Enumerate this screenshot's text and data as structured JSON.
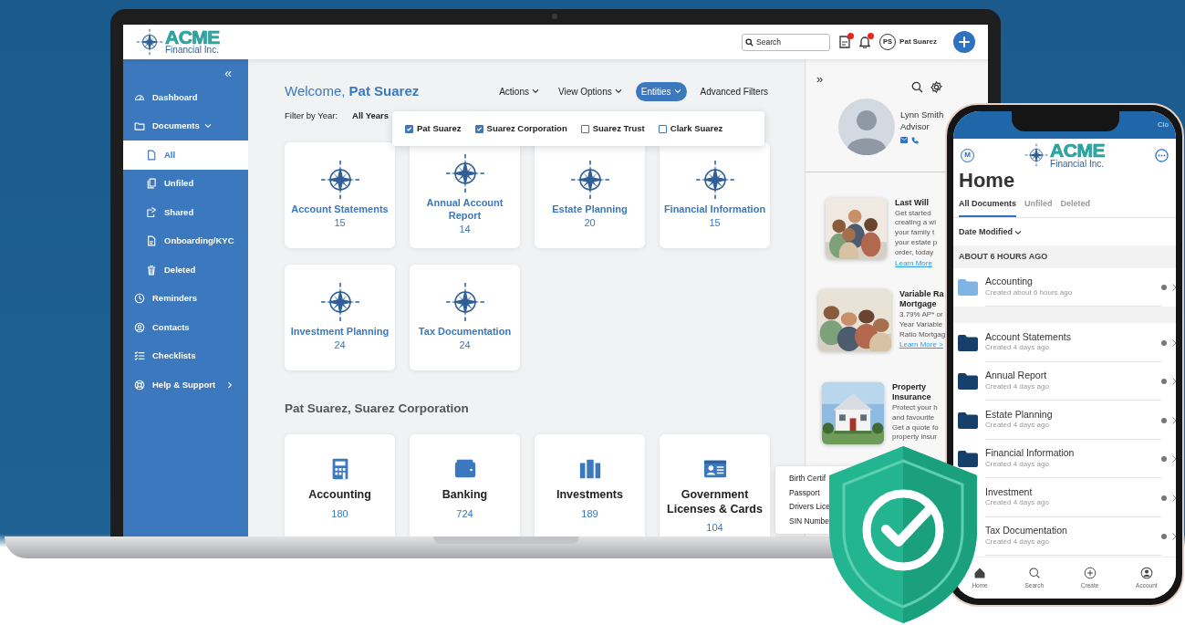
{
  "header": {
    "logo_mark": "ACME",
    "logo_sub": "Financial Inc.",
    "search": {
      "placeholder": "Search"
    },
    "user": {
      "initials": "PS",
      "name": "Pat Suarez"
    }
  },
  "sidebar": {
    "collapse": "«",
    "items": [
      {
        "label": "Dashboard",
        "selected": false
      },
      {
        "label": "Documents",
        "selected": false,
        "expanded": true,
        "children": [
          {
            "label": "All",
            "selected": true
          },
          {
            "label": "Unfiled",
            "selected": false
          },
          {
            "label": "Shared",
            "selected": false
          },
          {
            "label": "Onboarding/KYC",
            "selected": false
          },
          {
            "label": "Deleted",
            "selected": false
          }
        ]
      },
      {
        "label": "Reminders",
        "selected": false
      },
      {
        "label": "Contacts",
        "selected": false
      },
      {
        "label": "Checklists",
        "selected": false
      },
      {
        "label": "Help & Support",
        "selected": false,
        "expanded": false
      }
    ]
  },
  "main": {
    "greeting": "Welcome,",
    "user": "Pat Suarez",
    "menus": [
      {
        "label": "Actions",
        "kind": "dropdown",
        "selected": false
      },
      {
        "label": "View Options",
        "kind": "dropdown",
        "selected": false
      },
      {
        "label": "Entities",
        "kind": "dropdown",
        "selected": true
      },
      {
        "label": "Advanced Filters",
        "kind": "link",
        "selected": false
      }
    ],
    "filter": {
      "label": "Filter by Year:",
      "value": "All Years"
    },
    "entities": [
      {
        "label": "Pat Suarez",
        "checked": true
      },
      {
        "label": "Suarez Corporation",
        "checked": true
      },
      {
        "label": "Suarez Trust",
        "checked": false
      },
      {
        "label": "Clark Suarez",
        "checked": false
      }
    ],
    "folders": [
      {
        "title": "Account Statements",
        "count": "15"
      },
      {
        "title": "Annual Account Report",
        "count": "14"
      },
      {
        "title": "Estate Planning",
        "count": "20"
      },
      {
        "title": "Financial Information",
        "count": "15"
      },
      {
        "title": "Investment Planning",
        "count": "24"
      },
      {
        "title": "Tax Documentation",
        "count": "24"
      }
    ],
    "section_title": "Pat Suarez, Suarez Corporation",
    "categories": [
      {
        "kind": "calculator",
        "title": "Accounting",
        "count": "180"
      },
      {
        "kind": "wallet",
        "title": "Banking",
        "count": "724"
      },
      {
        "kind": "binders",
        "title": "Investments",
        "count": "189"
      },
      {
        "kind": "id-card",
        "title": "Government Licenses & Cards",
        "count": "104"
      }
    ],
    "tooltip": [
      "Birth Certif",
      "Passport",
      "Drivers Lice",
      "SIN Numbe"
    ]
  },
  "right_panel": {
    "expand": "»",
    "advisor": {
      "name": "Lynn Smith",
      "role": "Advisor"
    },
    "promos": [
      {
        "kind": "family",
        "title_lines": [
          "Last Will"
        ],
        "lines": [
          "Get started",
          "creating a wi",
          "your family t",
          "your estate p",
          "order, today"
        ],
        "link": "Learn More"
      },
      {
        "kind": "family",
        "title_lines": [
          "Variable Ra",
          "Mortgage"
        ],
        "lines": [
          "3.79% AP* or",
          "Year Variable",
          "Ratio Mortgag"
        ],
        "link": "Learn More >"
      },
      {
        "kind": "house",
        "title_lines": [
          "Property",
          "Insurance"
        ],
        "lines": [
          "Protect your h",
          "and favourite",
          "Get a quote fo",
          "property insur"
        ]
      }
    ]
  },
  "phone": {
    "status": "Clo",
    "badge": "M",
    "logo_mark": "ACME",
    "logo_sub": "Financial Inc.",
    "title": "Home",
    "tabs": [
      {
        "label": "All Documents",
        "selected": true
      },
      {
        "label": "Unfiled",
        "selected": false
      },
      {
        "label": "Deleted",
        "selected": false
      }
    ],
    "sort": "Date Modified",
    "groups": [
      {
        "heading": "ABOUT 6 HOURS AGO",
        "items": [
          {
            "title": "Accounting",
            "subtitle": "Created about 6 hours ago",
            "color": "#7fb4e4"
          }
        ]
      },
      {
        "items": [
          {
            "title": "Account Statements",
            "subtitle": "Created 4 days ago",
            "color": "#163f69"
          },
          {
            "title": "Annual Report",
            "subtitle": "Created 4 days ago",
            "color": "#163f69"
          },
          {
            "title": "Estate Planning",
            "subtitle": "Created 4 days ago",
            "color": "#163f69"
          },
          {
            "title": "Financial Information",
            "subtitle": "Created 4 days ago",
            "color": "#163f69"
          },
          {
            "title": "Investment",
            "subtitle": "Created 4 days ago"
          },
          {
            "title": "Tax Documentation",
            "subtitle": "Created 4 days ago"
          }
        ]
      }
    ],
    "nav": [
      {
        "label": "Home",
        "selected": true
      },
      {
        "label": "Search",
        "selected": false
      },
      {
        "label": "Create",
        "selected": false
      },
      {
        "label": "Account",
        "selected": false
      }
    ]
  }
}
